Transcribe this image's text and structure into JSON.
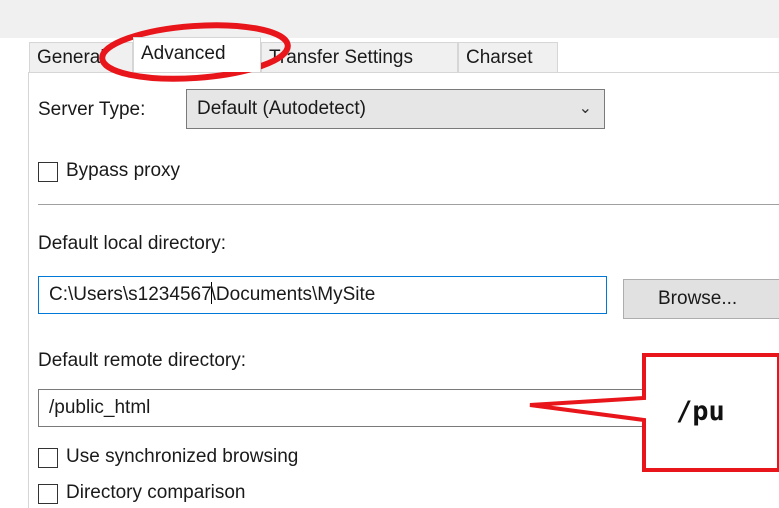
{
  "tabs": [
    {
      "label": "General"
    },
    {
      "label": "Advanced"
    },
    {
      "label": "Transfer Settings"
    },
    {
      "label": "Charset"
    }
  ],
  "server_type": {
    "label": "Server Type:",
    "value": "Default (Autodetect)"
  },
  "bypass_proxy": {
    "label": "Bypass proxy",
    "checked": false
  },
  "local_dir": {
    "label": "Default local directory:",
    "value_before_caret": "C:\\Users\\s1234567",
    "value_after_caret": "\\Documents\\MySite"
  },
  "browse_button": {
    "label": "Browse..."
  },
  "remote_dir": {
    "label": "Default remote directory:",
    "value": "/public_html"
  },
  "sync_browsing": {
    "label": "Use synchronized browsing",
    "checked": false
  },
  "dir_comparison": {
    "label": "Directory comparison",
    "checked": false
  },
  "callout": {
    "text": "/pu",
    "color": "#e8161b"
  },
  "annotation": {
    "color": "#e8161b",
    "target": "tab-advanced"
  }
}
